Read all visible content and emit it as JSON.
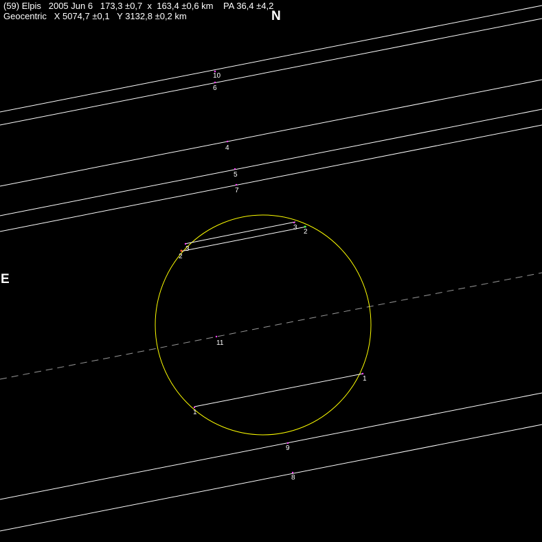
{
  "header": {
    "line1": "(59) Elpis   2005 Jun 6   173,3 ±0,7  x  163,4 ±0,6 km    PA 36,4 ±4,2",
    "line2": "Geocentric   X 5074,7 ±0,1   Y 3132,8 ±0,2 km"
  },
  "compass": {
    "north": "N",
    "east": "E"
  },
  "colors": {
    "background": "#000000",
    "chord": "#ffffff",
    "ellipse": "#ffff00",
    "marker": "#ff44ff",
    "center_line": "#999999"
  },
  "chords": [
    {
      "id": "10",
      "label": "10"
    },
    {
      "id": "6",
      "label": "6"
    },
    {
      "id": "4",
      "label": "4"
    },
    {
      "id": "5",
      "label": "5"
    },
    {
      "id": "7",
      "label": "7"
    },
    {
      "id": "3",
      "label_a": "3",
      "label_b": "3"
    },
    {
      "id": "2",
      "label_a": "2",
      "label_b": "2"
    },
    {
      "id": "11",
      "label": "11"
    },
    {
      "id": "1",
      "label_a": "1",
      "label_b": "1"
    },
    {
      "id": "9",
      "label": "9"
    },
    {
      "id": "8",
      "label": "8"
    }
  ]
}
